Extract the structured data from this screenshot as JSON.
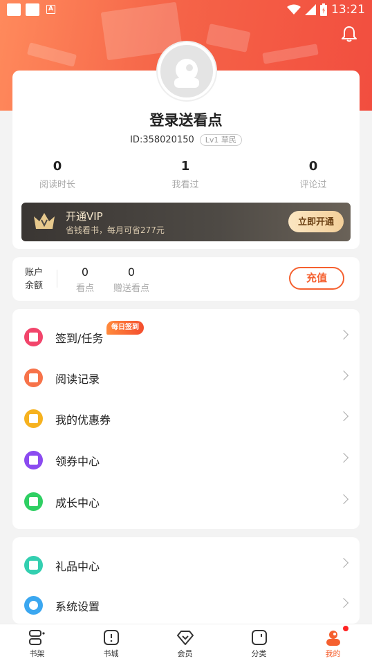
{
  "status_bar": {
    "time": "13:21"
  },
  "profile": {
    "title": "登录送看点",
    "id_text": "ID:358020150",
    "level": "Lv1 草民",
    "stats": [
      {
        "value": "0",
        "label": "阅读时长"
      },
      {
        "value": "1",
        "label": "我看过"
      },
      {
        "value": "0",
        "label": "评论过"
      }
    ]
  },
  "vip": {
    "title": "开通VIP",
    "subtitle": "省钱看书，每月可省277元",
    "button": "立即开通"
  },
  "balance": {
    "label": "账户余额",
    "items": [
      {
        "value": "0",
        "label": "看点"
      },
      {
        "value": "0",
        "label": "赠送看点"
      }
    ],
    "button": "充值"
  },
  "menu1": [
    {
      "label": "签到/任务",
      "badge": "每日签到",
      "icon": "calendar-icon",
      "color": "#f2456b"
    },
    {
      "label": "阅读记录",
      "icon": "book-icon",
      "color": "#f7734a"
    },
    {
      "label": "我的优惠券",
      "icon": "ticket-icon",
      "color": "#f6b21f"
    },
    {
      "label": "领券中心",
      "icon": "flag-icon",
      "color": "#8b4bf0"
    },
    {
      "label": "成长中心",
      "icon": "star-icon",
      "color": "#2fcf63"
    }
  ],
  "menu2": [
    {
      "label": "礼品中心",
      "icon": "gift-icon",
      "color": "#33cfb0"
    },
    {
      "label": "系统设置",
      "icon": "gear-icon",
      "color": "#3ba7f0"
    }
  ],
  "tabs": [
    {
      "label": "书架",
      "icon": "bookshelf-icon"
    },
    {
      "label": "书城",
      "icon": "bookstore-icon"
    },
    {
      "label": "会员",
      "icon": "diamond-icon"
    },
    {
      "label": "分类",
      "icon": "category-icon"
    },
    {
      "label": "我的",
      "icon": "profile-icon",
      "active": true
    }
  ],
  "colors": {
    "accent": "#f5602f",
    "header": "#f56448"
  }
}
